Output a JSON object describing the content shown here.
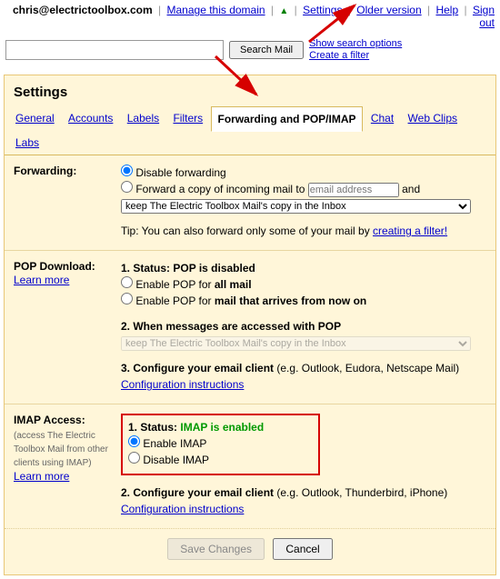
{
  "header": {
    "email": "chris@electrictoolbox.com",
    "manage": "Manage this domain",
    "settings": "Settings",
    "older": "Older version",
    "help": "Help",
    "signout": "Sign out"
  },
  "search": {
    "button": "Search Mail",
    "show_opts": "Show search options",
    "create_filter": "Create a filter"
  },
  "title": "Settings",
  "tabs": {
    "general": "General",
    "accounts": "Accounts",
    "labels": "Labels",
    "filters": "Filters",
    "fpop": "Forwarding and POP/IMAP",
    "chat": "Chat",
    "webclips": "Web Clips",
    "labs": "Labs"
  },
  "forwarding": {
    "label": "Forwarding:",
    "disable": "Disable forwarding",
    "forward_prefix": "Forward a copy of incoming mail to",
    "email_placeholder": "email address",
    "and": "and",
    "keep_select": "keep The Electric Toolbox Mail's copy in the Inbox",
    "tip_prefix": "Tip: You can also forward only some of your mail by",
    "tip_link": "creating a filter!"
  },
  "pop": {
    "label": "POP Download:",
    "learn": "Learn more",
    "status_label": "1. Status:",
    "status_value": "POP is disabled",
    "opt_all_prefix": "Enable POP for",
    "opt_all_bold": "all mail",
    "opt_now_prefix": "Enable POP for",
    "opt_now_bold": "mail that arrives from now on",
    "when": "2. When messages are accessed with POP",
    "when_select": "keep The Electric Toolbox Mail's copy in the Inbox",
    "configure_prefix": "3. Configure your email client",
    "configure_suffix": "(e.g. Outlook, Eudora, Netscape Mail)",
    "config_link": "Configuration instructions"
  },
  "imap": {
    "label": "IMAP Access:",
    "sub": "(access The Electric Toolbox Mail from other clients using IMAP)",
    "learn": "Learn more",
    "status_label": "1. Status:",
    "status_value": "IMAP is enabled",
    "enable": "Enable IMAP",
    "disable": "Disable IMAP",
    "configure_prefix": "2. Configure your email client",
    "configure_suffix": "(e.g. Outlook, Thunderbird, iPhone)",
    "config_link": "Configuration instructions"
  },
  "footer": {
    "save": "Save Changes",
    "cancel": "Cancel"
  }
}
